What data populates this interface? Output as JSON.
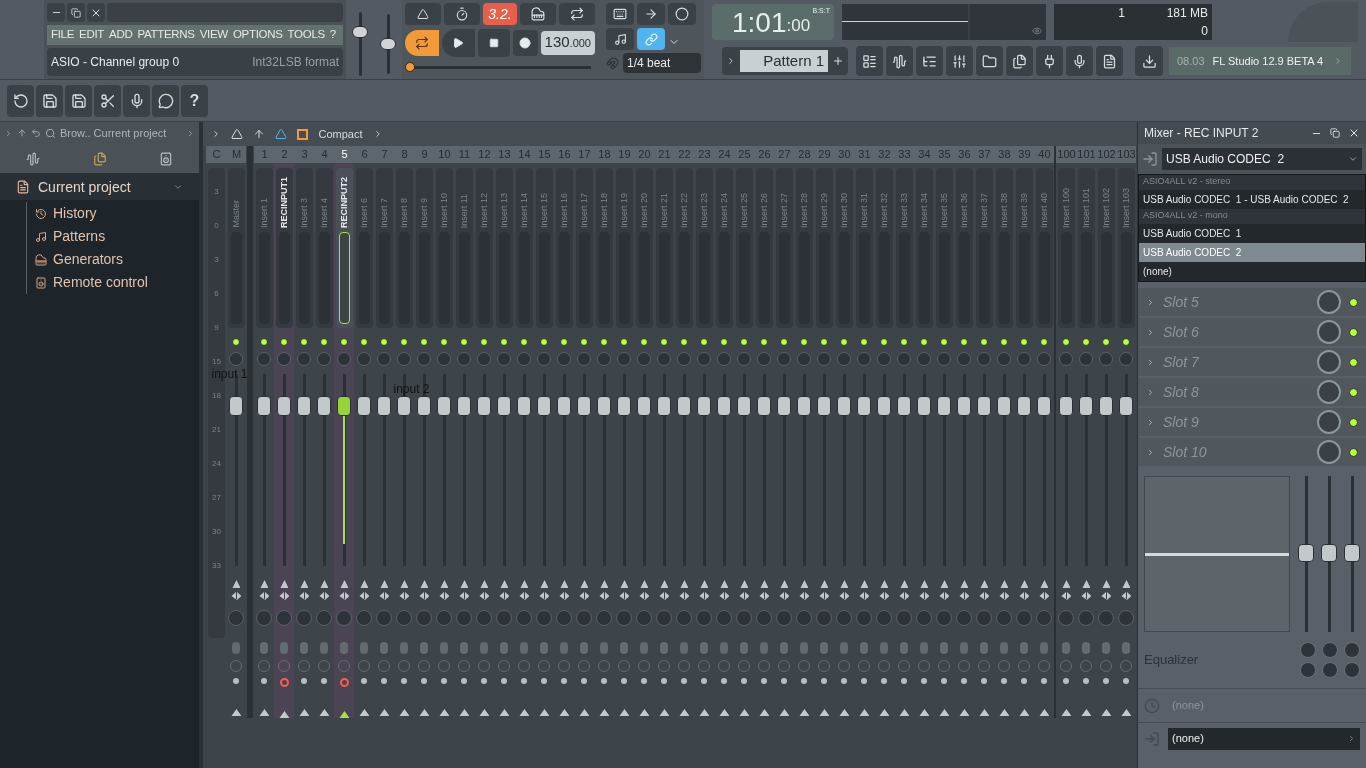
{
  "title_bar": {
    "menu": [
      "FILE",
      "EDIT",
      "ADD",
      "PATTERNS",
      "VIEW",
      "OPTIONS",
      "TOOLS",
      "?"
    ],
    "hint": "ASIO - Channel group 0",
    "hint_right": "Int32LSB format"
  },
  "toolbar": {
    "help": "?"
  },
  "master_volume": {
    "level": 0.72
  },
  "master_pitch": {
    "level": 0.5
  },
  "transport": {
    "countdown": "3.2.",
    "song_mode": true,
    "tempo": "130",
    "tempo_decimals": ".000",
    "song_position": {
      "level": 0.0
    }
  },
  "tools": {
    "link_on": true,
    "snap": "1/4 beat"
  },
  "time_display": {
    "time": "1:01",
    "ticks": ":00",
    "format": "B:S:T"
  },
  "pattern": {
    "name": "Pattern 1"
  },
  "cpu": {
    "cpu": "1",
    "memory": "181 MB",
    "polyphony": "0"
  },
  "news": {
    "date": "08.03",
    "text": "FL Studio 12.9 BETA 4"
  },
  "browser": {
    "path": "Brow.. Current project",
    "root": "Current project",
    "items": [
      "History",
      "Patterns",
      "Generators",
      "Remote control"
    ]
  },
  "mixer": {
    "view": "Compact",
    "scale_header": "C",
    "scale": [
      "3",
      "0",
      "3",
      "6",
      "9",
      "15",
      "18",
      "21",
      "24",
      "27",
      "30",
      "33"
    ],
    "tracks": [
      {
        "number": "M",
        "name": "Master",
        "selected": false,
        "armed": false
      },
      {
        "number": "1",
        "name": "Insert 1",
        "selected": false,
        "armed": false
      },
      {
        "number": "2",
        "name": "RECINPUT1",
        "selected": false,
        "armed": true
      },
      {
        "number": "3",
        "name": "Insert 3",
        "selected": false,
        "armed": false
      },
      {
        "number": "4",
        "name": "Insert 4",
        "selected": false,
        "armed": false
      },
      {
        "number": "5",
        "name": "RECINPUT2",
        "selected": true,
        "armed": true
      },
      {
        "number": "6",
        "name": "Insert 6",
        "selected": false,
        "armed": false
      },
      {
        "number": "7",
        "name": "Insert 7",
        "selected": false,
        "armed": false
      },
      {
        "number": "8",
        "name": "Insert 8",
        "selected": false,
        "armed": false
      },
      {
        "number": "9",
        "name": "Insert 9",
        "selected": false,
        "armed": false
      },
      {
        "number": "10",
        "name": "Insert 10",
        "selected": false,
        "armed": false
      },
      {
        "number": "11",
        "name": "Insert 11",
        "selected": false,
        "armed": false
      },
      {
        "number": "12",
        "name": "Insert 12",
        "selected": false,
        "armed": false
      },
      {
        "number": "13",
        "name": "Insert 13",
        "selected": false,
        "armed": false
      },
      {
        "number": "14",
        "name": "Insert 14",
        "selected": false,
        "armed": false
      },
      {
        "number": "15",
        "name": "Insert 15",
        "selected": false,
        "armed": false
      },
      {
        "number": "16",
        "name": "Insert 16",
        "selected": false,
        "armed": false
      },
      {
        "number": "17",
        "name": "Insert 17",
        "selected": false,
        "armed": false
      },
      {
        "number": "18",
        "name": "Insert 18",
        "selected": false,
        "armed": false
      },
      {
        "number": "19",
        "name": "Insert 19",
        "selected": false,
        "armed": false
      },
      {
        "number": "20",
        "name": "Insert 20",
        "selected": false,
        "armed": false
      },
      {
        "number": "21",
        "name": "Insert 21",
        "selected": false,
        "armed": false
      },
      {
        "number": "22",
        "name": "Insert 22",
        "selected": false,
        "armed": false
      },
      {
        "number": "23",
        "name": "Insert 23",
        "selected": false,
        "armed": false
      },
      {
        "number": "24",
        "name": "Insert 24",
        "selected": false,
        "armed": false
      },
      {
        "number": "25",
        "name": "Insert 25",
        "selected": false,
        "armed": false
      },
      {
        "number": "26",
        "name": "Insert 26",
        "selected": false,
        "armed": false
      },
      {
        "number": "27",
        "name": "Insert 27",
        "selected": false,
        "armed": false
      },
      {
        "number": "28",
        "name": "Insert 28",
        "selected": false,
        "armed": false
      },
      {
        "number": "29",
        "name": "Insert 29",
        "selected": false,
        "armed": false
      },
      {
        "number": "30",
        "name": "Insert 30",
        "selected": false,
        "armed": false
      },
      {
        "number": "31",
        "name": "Insert 31",
        "selected": false,
        "armed": false
      },
      {
        "number": "32",
        "name": "Insert 32",
        "selected": false,
        "armed": false
      },
      {
        "number": "33",
        "name": "Insert 33",
        "selected": false,
        "armed": false
      },
      {
        "number": "34",
        "name": "Insert 34",
        "selected": false,
        "armed": false
      },
      {
        "number": "35",
        "name": "Insert 35",
        "selected": false,
        "armed": false
      },
      {
        "number": "36",
        "name": "Insert 36",
        "selected": false,
        "armed": false
      },
      {
        "number": "37",
        "name": "Insert 37",
        "selected": false,
        "armed": false
      },
      {
        "number": "38",
        "name": "Insert 38",
        "selected": false,
        "armed": false
      },
      {
        "number": "39",
        "name": "Insert 39",
        "selected": false,
        "armed": false
      },
      {
        "number": "40",
        "name": "Insert 40",
        "selected": false,
        "armed": false
      },
      {
        "number": "100",
        "name": "Insert 100",
        "selected": false,
        "armed": false
      },
      {
        "number": "101",
        "name": "Insert 101",
        "selected": false,
        "armed": false
      },
      {
        "number": "102",
        "name": "Insert 102",
        "selected": false,
        "armed": false
      },
      {
        "number": "103",
        "name": "Insert 103",
        "selected": false,
        "armed": false
      }
    ]
  },
  "annotations": [
    "input 1",
    "input 2"
  ],
  "mixer_panel": {
    "title": "Mixer - REC INPUT 2",
    "input": "USB Audio CODEC  2",
    "input_menu": [
      {
        "kind": "header",
        "label": "ASIO4ALL v2 - stereo"
      },
      {
        "kind": "option",
        "label": "USB Audio CODEC  1 - USB Audio CODEC  2",
        "selected": false
      },
      {
        "kind": "header",
        "label": "ASIO4ALL v2 - mono"
      },
      {
        "kind": "option",
        "label": "USB Audio CODEC  1",
        "selected": false
      },
      {
        "kind": "option",
        "label": "USB Audio CODEC  2",
        "selected": true
      },
      {
        "kind": "option",
        "label": "(none)",
        "selected": false
      }
    ],
    "slots": [
      "Slot 5",
      "Slot 6",
      "Slot 7",
      "Slot 8",
      "Slot 9",
      "Slot 10"
    ],
    "eq_label": "Equalizer",
    "latency": "(none)",
    "output": "(none)"
  }
}
